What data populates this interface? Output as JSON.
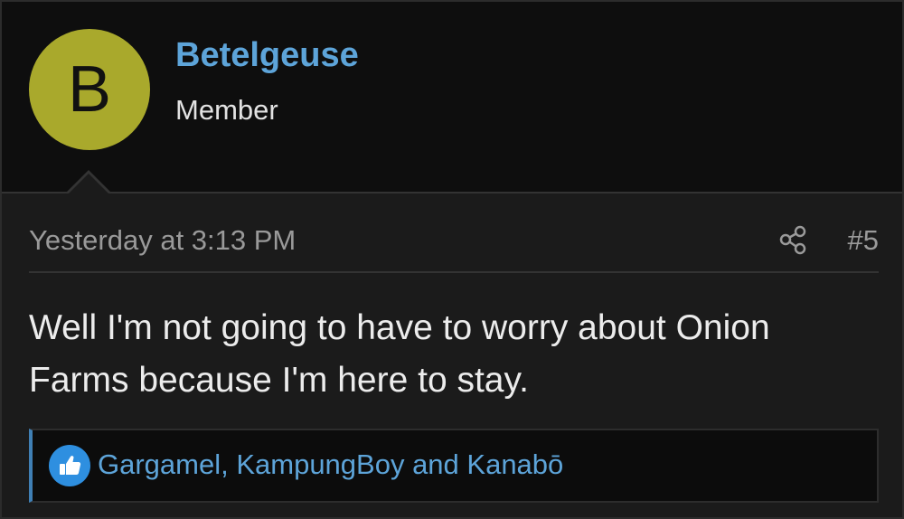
{
  "user": {
    "avatar_letter": "B",
    "avatar_color": "#a9a92c",
    "name": "Betelgeuse",
    "title": "Member"
  },
  "meta": {
    "timestamp": "Yesterday at 3:13 PM",
    "share_icon": "share-icon",
    "post_number": "#5"
  },
  "message": {
    "text": "Well I'm not going to have to worry about Onion Farms because I'm here to stay."
  },
  "reactions": {
    "icon": "thumbs-up-icon",
    "users_text": "Gargamel, KampungBoy and Kanabō"
  },
  "colors": {
    "link": "#5da4d9",
    "like": "#2e8fe0"
  }
}
